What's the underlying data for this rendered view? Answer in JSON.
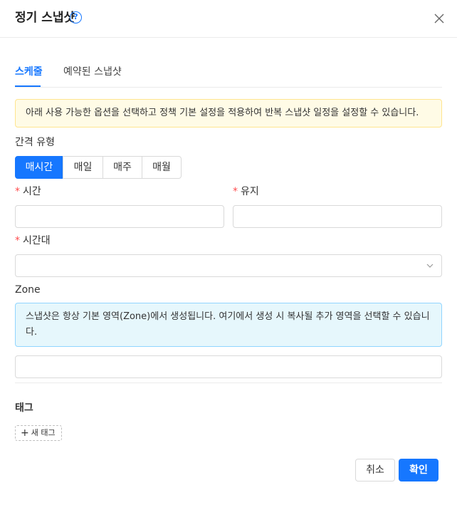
{
  "dialog": {
    "title": "정기 스냅샷",
    "help_glyph": "?"
  },
  "tabs": [
    {
      "label": "스케줄",
      "active": true
    },
    {
      "label": "예약된 스냅샷",
      "active": false
    }
  ],
  "schedule": {
    "notice": "아래 사용 가능한 옵션을 선택하고 정책 기본 설정을 적용하여 반복 스냅샷 일정을 설정할 수 있습니다.",
    "interval_label": "간격 유형",
    "interval_options": [
      "매시간",
      "매일",
      "매주",
      "매월"
    ],
    "interval_selected": "매시간",
    "required_mark": "*",
    "time_label": "시간",
    "time_value": "",
    "retention_label": "유지",
    "retention_value": "",
    "timezone_label": "시간대",
    "timezone_value": "",
    "zone_label": "Zone",
    "zone_notice": "스냅샷은 항상 기본 영역(Zone)에서 생성됩니다. 여기에서 생성 시 복사될 추가 영역을 선택할 수 있습니다.",
    "zone_value": ""
  },
  "tags": {
    "label": "태그",
    "new_tag_label": "새 태그"
  },
  "footer": {
    "cancel_label": "취소",
    "ok_label": "확인"
  },
  "colors": {
    "accent": "#1677ff",
    "required": "#ff4d4f",
    "warning_bg": "#fffbe6",
    "info_bg": "#e6f7fc"
  }
}
